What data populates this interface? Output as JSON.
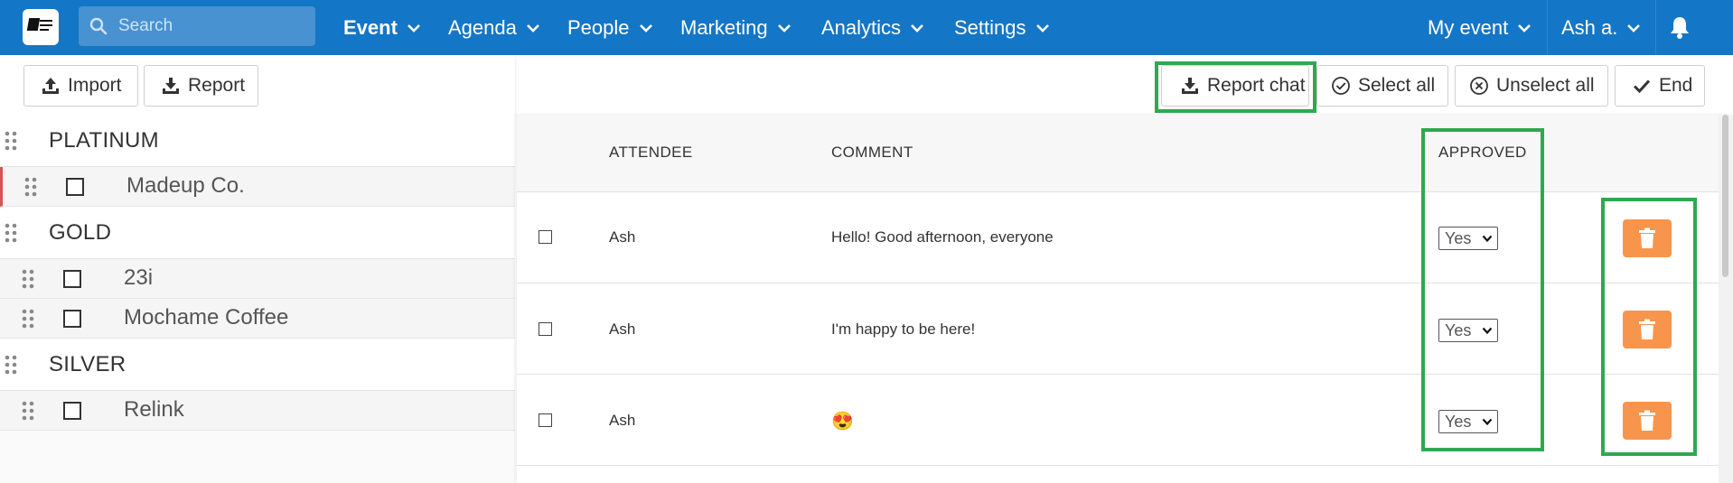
{
  "nav": {
    "search_placeholder": "Search",
    "items": [
      {
        "label": "Event"
      },
      {
        "label": "Agenda"
      },
      {
        "label": "People"
      },
      {
        "label": "Marketing"
      },
      {
        "label": "Analytics"
      },
      {
        "label": "Settings"
      }
    ],
    "my_event": "My event",
    "user": "Ash a.",
    "color": "#1476c6"
  },
  "left_toolbar": {
    "import_label": "Import",
    "report_label": "Report"
  },
  "sponsors": {
    "groups": [
      {
        "label": "PLATINUM",
        "items": [
          {
            "label": "Madeup Co."
          }
        ]
      },
      {
        "label": "GOLD",
        "items": [
          {
            "label": "23i"
          },
          {
            "label": "Mochame Coffee"
          }
        ]
      },
      {
        "label": "SILVER",
        "items": [
          {
            "label": "Relink"
          }
        ]
      }
    ]
  },
  "right_toolbar": {
    "report_chat_label": "Report chat",
    "select_all_label": "Select all",
    "unselect_all_label": "Unselect all",
    "end_label": "End"
  },
  "table": {
    "headers": {
      "attendee": "ATTENDEE",
      "comment": "COMMENT",
      "approved": "APPROVED"
    },
    "rows": [
      {
        "attendee": "Ash",
        "comment": "Hello! Good afternoon, everyone",
        "approved": "Yes"
      },
      {
        "attendee": "Ash",
        "comment": "I'm happy to be here!",
        "approved": "Yes"
      },
      {
        "attendee": "Ash",
        "comment": "😍",
        "approved": "Yes"
      }
    ]
  },
  "colors": {
    "highlight": "#2fa84f",
    "delete": "#f7954d",
    "active_marker": "#d9534f"
  }
}
